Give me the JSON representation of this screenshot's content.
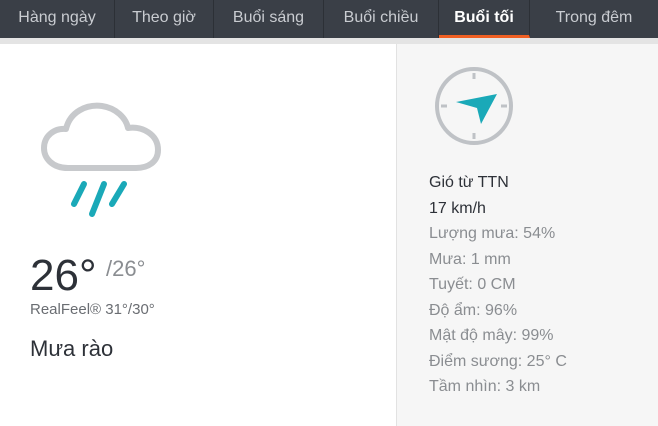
{
  "tabs": [
    {
      "label": "Hàng ngày",
      "active": false
    },
    {
      "label": "Theo giờ",
      "active": false
    },
    {
      "label": "Buổi sáng",
      "active": false
    },
    {
      "label": "Buổi chiều",
      "active": false
    },
    {
      "label": "Buổi tối",
      "active": true
    },
    {
      "label": "Trong đêm",
      "active": false
    }
  ],
  "weather": {
    "icon": "rain-cloud-icon",
    "temp_high": "26°",
    "temp_low": "/26°",
    "realfeel": "RealFeel® 31°/30°",
    "condition": "Mưa rào"
  },
  "wind": {
    "icon": "wind-compass-icon",
    "direction_label": "Gió từ TTN",
    "speed": "17 km/h"
  },
  "details": [
    "Lượng mưa: 54%",
    "Mưa: 1 mm",
    "Tuyết: 0 CM",
    "Độ ẩm: 96%",
    "Mật độ mây: 99%",
    "Điểm sương: 25° C",
    "Tầm nhìn: 3 km"
  ],
  "colors": {
    "tab_bar": "#3a3f47",
    "accent": "#f05f23",
    "icon_teal": "#1aa9b8",
    "cloud_gray": "#c7c9cc"
  }
}
